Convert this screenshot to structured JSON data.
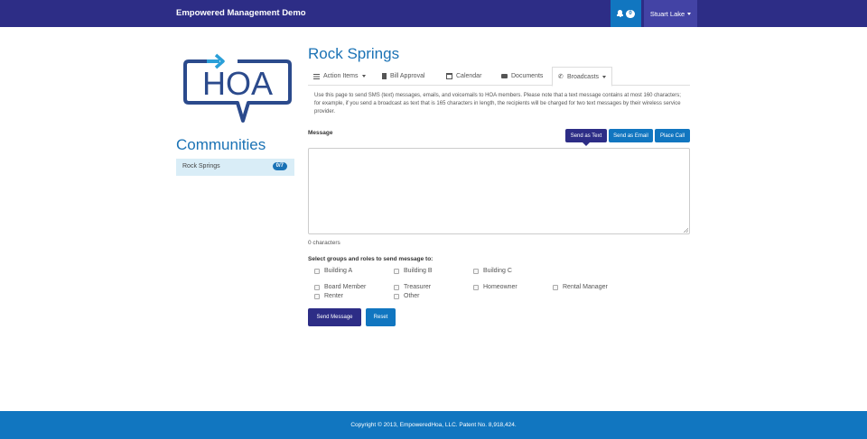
{
  "navbar": {
    "brand": "Empowered Management Demo",
    "notifications_count": "0",
    "user_name": "Stuart Lake"
  },
  "sidebar": {
    "logo_text": "HOA",
    "communities_title": "Communities",
    "communities": [
      {
        "label": "Rock Springs",
        "badge": "0/7"
      }
    ]
  },
  "main": {
    "title": "Rock Springs",
    "tabs": [
      {
        "label": "Action Items",
        "icon": "list-icon"
      },
      {
        "label": "Bill Approval",
        "icon": "file-icon"
      },
      {
        "label": "Calendar",
        "icon": "calendar-icon"
      },
      {
        "label": "Documents",
        "icon": "folder-icon"
      },
      {
        "label": "Broadcasts",
        "icon": "phone-icon"
      }
    ],
    "description": "Use this page to send SMS (text) messages, emails, and voicemails to HOA members. Please note that a text message contains at most 160 characters; for example, if you send a broadcast as text that is 165 characters in length, the recipients will be charged for two text messages by their wireless service provider.",
    "message_label": "Message",
    "send_buttons": {
      "text": "Send as Text",
      "email": "Send as Email",
      "call": "Place Call"
    },
    "message_value": "",
    "char_count": "0 characters",
    "groups_label": "Select groups and roles to send message to:",
    "groups": [
      "Building A",
      "Building B",
      "Building C"
    ],
    "roles": [
      "Board Member",
      "Treasurer",
      "Homeowner",
      "Rental Manager",
      "Renter",
      "Other"
    ],
    "send_message_label": "Send Message",
    "reset_label": "Reset"
  },
  "footer": {
    "copyright": "Copyright © 2013, EmpoweredHoa, LLC. Patent No. 8,918,424."
  },
  "colors": {
    "navbar": "#2d2d86",
    "accent": "#1176c0",
    "title": "#1a72b5"
  }
}
